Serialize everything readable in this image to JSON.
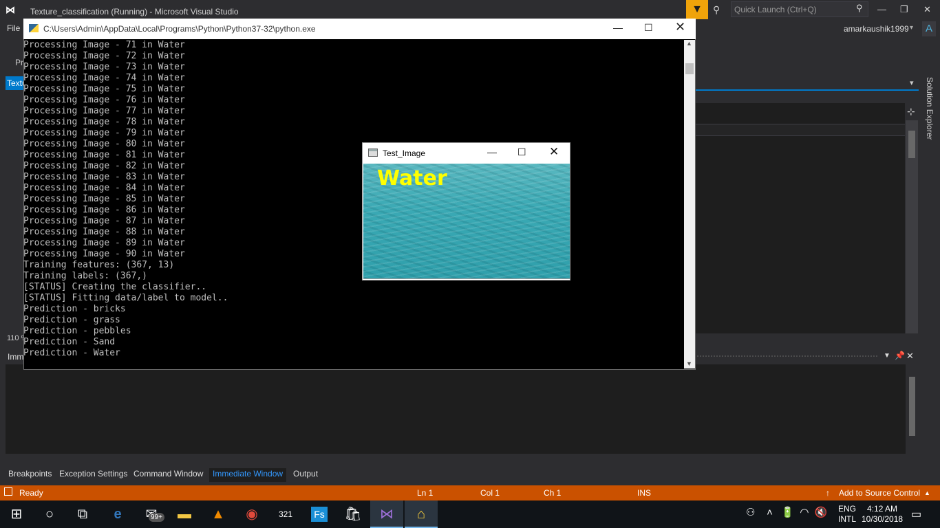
{
  "vs": {
    "title": "Texture_classification (Running) - Microsoft Visual Studio",
    "quick_launch_placeholder": "Quick Launch (Ctrl+Q)",
    "menu_file": "File",
    "user": "amarkaushik1999",
    "avatar_letter": "A",
    "toolbar_pr": "Pr",
    "doc_tab_label": "Textu",
    "solution_explorer": "Solution Explorer",
    "zoom": "110 %",
    "immediate_title": "Imm",
    "accent_color": "#007acc",
    "status_color": "#ca5100"
  },
  "bottom_tabs": [
    "Breakpoints",
    "Exception Settings",
    "Command Window",
    "Immediate Window",
    "Output"
  ],
  "statusbar": {
    "ready": "Ready",
    "ln": "Ln 1",
    "col": "Col 1",
    "ch": "Ch 1",
    "ins": "INS",
    "source_control": "Add to Source Control"
  },
  "console": {
    "title": "C:\\Users\\Admin\\AppData\\Local\\Programs\\Python\\Python37-32\\python.exe",
    "lines": [
      "Processing Image - 71 in Water",
      "Processing Image - 72 in Water",
      "Processing Image - 73 in Water",
      "Processing Image - 74 in Water",
      "Processing Image - 75 in Water",
      "Processing Image - 76 in Water",
      "Processing Image - 77 in Water",
      "Processing Image - 78 in Water",
      "Processing Image - 79 in Water",
      "Processing Image - 80 in Water",
      "Processing Image - 81 in Water",
      "Processing Image - 82 in Water",
      "Processing Image - 83 in Water",
      "Processing Image - 84 in Water",
      "Processing Image - 85 in Water",
      "Processing Image - 86 in Water",
      "Processing Image - 87 in Water",
      "Processing Image - 88 in Water",
      "Processing Image - 89 in Water",
      "Processing Image - 90 in Water",
      "Training features: (367, 13)",
      "Training labels: (367,)",
      "[STATUS] Creating the classifier..",
      "[STATUS] Fitting data/label to model..",
      "Prediction - bricks",
      "Prediction - grass",
      "Prediction - pebbles",
      "Prediction - Sand",
      "Prediction - Water"
    ]
  },
  "test_window": {
    "title": "Test_Image",
    "label": "Water"
  },
  "taskbar": {
    "icons": [
      "windows-start-icon",
      "cortana-icon",
      "task-view-icon",
      "edge-icon",
      "mail-icon",
      "file-explorer-icon",
      "vlc-icon",
      "chrome-icon",
      "calendar-icon",
      "fs-icon",
      "store-icon",
      "visual-studio-icon",
      "python-icon"
    ],
    "mail_badge": "99+",
    "fs_label": "Fs",
    "calendar_label": "321",
    "lang_top": "ENG",
    "lang_bottom": "INTL",
    "time": "4:12 AM",
    "date": "10/30/2018"
  }
}
